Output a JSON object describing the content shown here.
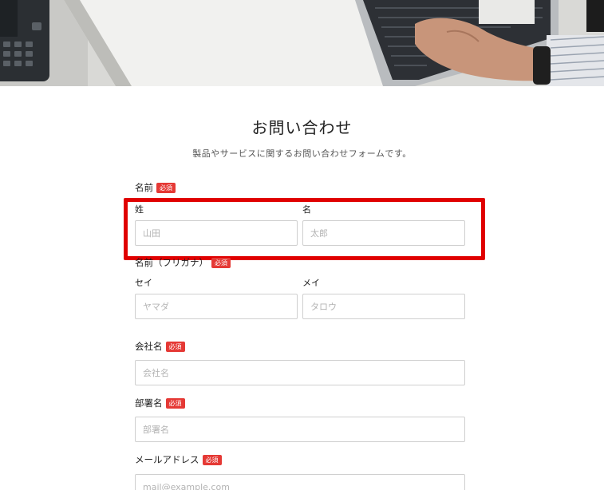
{
  "form": {
    "title": "お問い合わせ",
    "subtitle": "製品やサービスに関するお問い合わせフォームです。",
    "required_badge": "必須",
    "name": {
      "label": "名前",
      "last_label": "姓",
      "first_label": "名",
      "last_placeholder": "山田",
      "first_placeholder": "太郎"
    },
    "name_kana": {
      "label": "名前（フリガナ）",
      "last_label": "セイ",
      "first_label": "メイ",
      "last_placeholder": "ヤマダ",
      "first_placeholder": "タロウ"
    },
    "company": {
      "label": "会社名",
      "placeholder": "会社名"
    },
    "department": {
      "label": "部署名",
      "placeholder": "部署名"
    },
    "email": {
      "label": "メールアドレス",
      "placeholder": "mail@example.com"
    }
  },
  "colors": {
    "required_badge": "#e53935",
    "highlight": "#e00000",
    "input_border": "#cfcfcf"
  }
}
